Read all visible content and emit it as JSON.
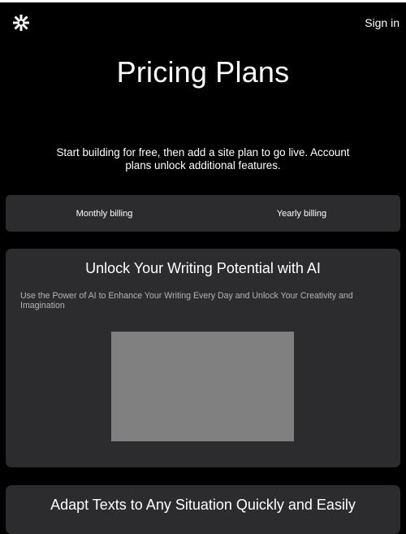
{
  "header": {
    "logo_icon": "asterisk-logo-icon",
    "signin_label": "Sign in"
  },
  "hero": {
    "title": "Pricing Plans",
    "subtitle": "Start building for free, then add a site plan to go live. Account plans unlock additional features."
  },
  "billing": {
    "monthly_label": "Monthly billing",
    "yearly_label": "Yearly billing"
  },
  "features": [
    {
      "title": "Unlock Your Writing Potential with AI",
      "description": "Use the Power of AI to Enhance Your Writing Every Day and Unlock Your Creativity and Imagination",
      "image_placeholder_color": "#808080"
    },
    {
      "title": "Adapt Texts to Any Situation Quickly and Easily"
    }
  ],
  "colors": {
    "background": "#000000",
    "card": "#2c2b2d",
    "text": "#ffffff",
    "muted_text": "#b4b4b4"
  }
}
